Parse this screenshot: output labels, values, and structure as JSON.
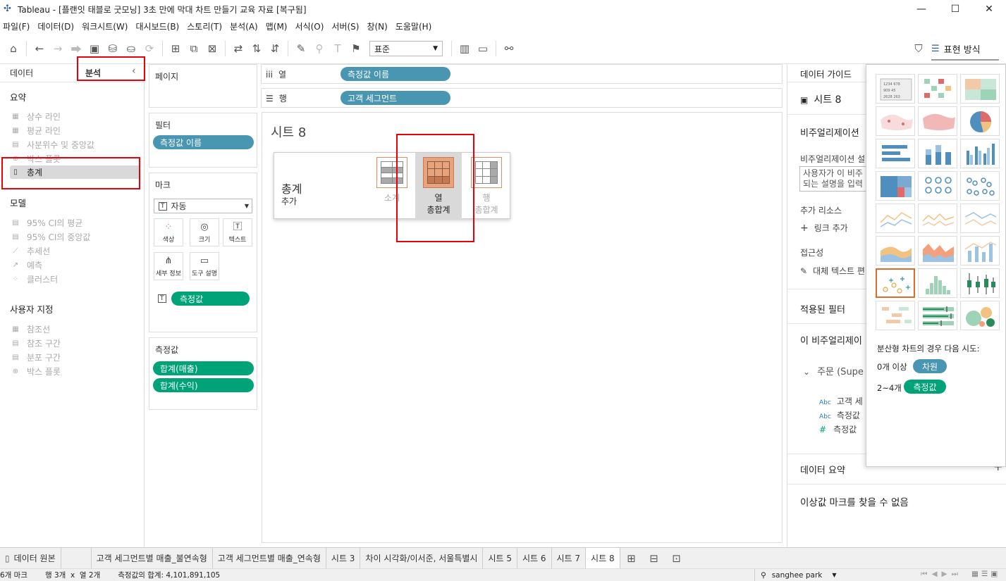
{
  "window": {
    "title": "Tableau - [플랜잇 태블로 굿모닝] 3초 만에 막대 차트 만들기 교육 자료 [복구됨]",
    "minimize": "—",
    "maximize": "☐",
    "close": "✕"
  },
  "menu": [
    "파일(F)",
    "데이터(D)",
    "워크시트(W)",
    "대시보드(B)",
    "스토리(T)",
    "분석(A)",
    "맵(M)",
    "서식(O)",
    "서버(S)",
    "창(N)",
    "도움말(H)"
  ],
  "toolbar": {
    "fit_select": "표준",
    "format_tab": "표현 방식"
  },
  "left_panel": {
    "tab_data": "데이터",
    "tab_analysis": "분석",
    "summary_title": "요약",
    "summary_items": [
      "상수 라인",
      "평균 라인",
      "사분위수 및 중앙값",
      "박스 플롯",
      "총계"
    ],
    "model_title": "모델",
    "model_items": [
      "95% CI의 평균",
      "95% CI의 중앙값",
      "추세선",
      "예측",
      "클러스터"
    ],
    "custom_title": "사용자 지정",
    "custom_items": [
      "참조선",
      "참조 구간",
      "분포 구간",
      "박스 플롯"
    ]
  },
  "pages_card": {
    "title": "페이지"
  },
  "filters_card": {
    "title": "필터",
    "pills": [
      "측정값 이름"
    ]
  },
  "marks_card": {
    "title": "마크",
    "type": "자동",
    "buttons": [
      "색상",
      "크기",
      "텍스트",
      "세부 정보",
      "도구 설명"
    ],
    "pill": "측정값"
  },
  "measures_card": {
    "title": "측정값",
    "pills": [
      "합계(매출)",
      "합계(수익)"
    ]
  },
  "columns_shelf": {
    "label": "열",
    "pill": "측정값 이름"
  },
  "rows_shelf": {
    "label": "행",
    "pill": "고객 세그먼트"
  },
  "canvas": {
    "sheet_title": "시트 8"
  },
  "totals_popup": {
    "title": "총계",
    "subtitle": "추가",
    "options": [
      {
        "line1": "소계",
        "line2": ""
      },
      {
        "line1": "열",
        "line2": "총합계"
      },
      {
        "line1": "행",
        "line2": "총합계"
      }
    ]
  },
  "data_guide": {
    "tab": "데이터 가이드",
    "sheet": "시트 8",
    "viz_heading": "비주얼리제이션",
    "viz_desc_label": "비주얼리제이션 설",
    "viz_desc_placeholder1": "사용자가 이 비주",
    "viz_desc_placeholder2": "되는 설명을 입력",
    "resources_label": "추가 리소스",
    "add_link": "링크 추가",
    "accessibility": "접근성",
    "alt_text": "대체 텍스트 편",
    "applied_filters": "적용된 필터",
    "this_viz": "이 비주얼리제이",
    "orders": "주문 (Supe",
    "fields": [
      {
        "type": "Abc",
        "name": "고객 세"
      },
      {
        "type": "Abc",
        "name": "측정값"
      },
      {
        "type": "#",
        "name": "측정값"
      }
    ],
    "data_summary": "데이터 요약",
    "plus": "+",
    "outlier_msg": "이상값 마크를 찾을 수 없음"
  },
  "show_me": {
    "hint": "분산형 차트의 경우 다음 시도:",
    "rule1_prefix": "0개 이상",
    "rule1_pill": "차원",
    "rule2_prefix": "2~4개",
    "rule2_pill": "측정값",
    "selected_index": 18
  },
  "sheet_tabs": [
    "데이터 원본",
    "고객 세그먼트별 매출_불연속형",
    "고객 세그먼트별 매출_연속형",
    "시트 3",
    "차이 시각화/이서준, 서울특별시",
    "시트 5",
    "시트 6",
    "시트 7",
    "시트 8"
  ],
  "active_tab": "시트 8",
  "status": {
    "marks": "6개 마크",
    "rows_cols": "행 3개  x  열 2개",
    "sum": "측정값의 합계: 4,101,891,105",
    "user": "sanghee park"
  },
  "colors": {
    "pill_blue": "#4996b2",
    "pill_green": "#00a378",
    "highlight": "#e8000b",
    "selected_option": "#e8a27c"
  }
}
